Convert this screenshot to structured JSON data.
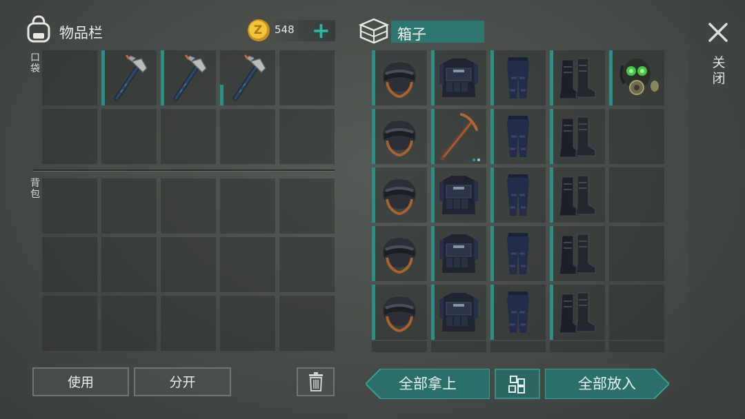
{
  "inventory": {
    "title": "物品栏",
    "pocket_label": "口袋",
    "backpack_label": "背包",
    "coins": "548",
    "pocket_slots": [
      {
        "item": "empty"
      },
      {
        "item": "hatchet-icon",
        "fill": 1.0
      },
      {
        "item": "hatchet-icon",
        "fill": 1.0
      },
      {
        "item": "hatchet-icon",
        "fill": 0.38
      },
      {
        "item": "empty"
      },
      {
        "item": "empty"
      },
      {
        "item": "empty"
      },
      {
        "item": "empty"
      },
      {
        "item": "empty"
      },
      {
        "item": "empty"
      }
    ],
    "backpack_slots": [
      {
        "item": "empty"
      },
      {
        "item": "empty"
      },
      {
        "item": "empty"
      },
      {
        "item": "empty"
      },
      {
        "item": "empty"
      },
      {
        "item": "empty"
      },
      {
        "item": "empty"
      },
      {
        "item": "empty"
      },
      {
        "item": "empty"
      },
      {
        "item": "empty"
      },
      {
        "item": "empty"
      },
      {
        "item": "empty"
      },
      {
        "item": "empty"
      },
      {
        "item": "empty"
      },
      {
        "item": "empty"
      }
    ]
  },
  "container": {
    "title": "箱子",
    "slots": [
      {
        "item": "helmet-icon",
        "fill": 1.0
      },
      {
        "item": "body-armor-icon",
        "fill": 1.0
      },
      {
        "item": "pants-icon",
        "fill": 1.0
      },
      {
        "item": "boots-icon",
        "fill": 1.0
      },
      {
        "item": "gas-mask-icon",
        "fill": 1.0
      },
      {
        "item": "helmet-icon",
        "fill": 1.0
      },
      {
        "item": "pickaxe-icon",
        "fill": 1.0
      },
      {
        "item": "pants-icon",
        "fill": 1.0
      },
      {
        "item": "boots-icon",
        "fill": 1.0
      },
      {
        "item": "empty"
      },
      {
        "item": "helmet-icon",
        "fill": 1.0
      },
      {
        "item": "body-armor-icon",
        "fill": 1.0
      },
      {
        "item": "pants-icon",
        "fill": 1.0
      },
      {
        "item": "boots-icon",
        "fill": 1.0
      },
      {
        "item": "empty"
      },
      {
        "item": "helmet-icon",
        "fill": 1.0
      },
      {
        "item": "body-armor-icon",
        "fill": 1.0
      },
      {
        "item": "pants-icon",
        "fill": 1.0
      },
      {
        "item": "boots-icon",
        "fill": 1.0
      },
      {
        "item": "empty"
      },
      {
        "item": "helmet-icon",
        "fill": 1.0
      },
      {
        "item": "body-armor-icon",
        "fill": 1.0
      },
      {
        "item": "pants-icon",
        "fill": 1.0
      },
      {
        "item": "boots-icon",
        "fill": 1.0
      },
      {
        "item": "empty"
      }
    ]
  },
  "actions": {
    "use": "使用",
    "split": "分开",
    "take_all": "全部拿上",
    "put_all": "全部放入",
    "close": "关闭"
  },
  "colors": {
    "accent": "#2fb3a5",
    "durability": "#2c8f86",
    "coin": "#d9a820"
  }
}
